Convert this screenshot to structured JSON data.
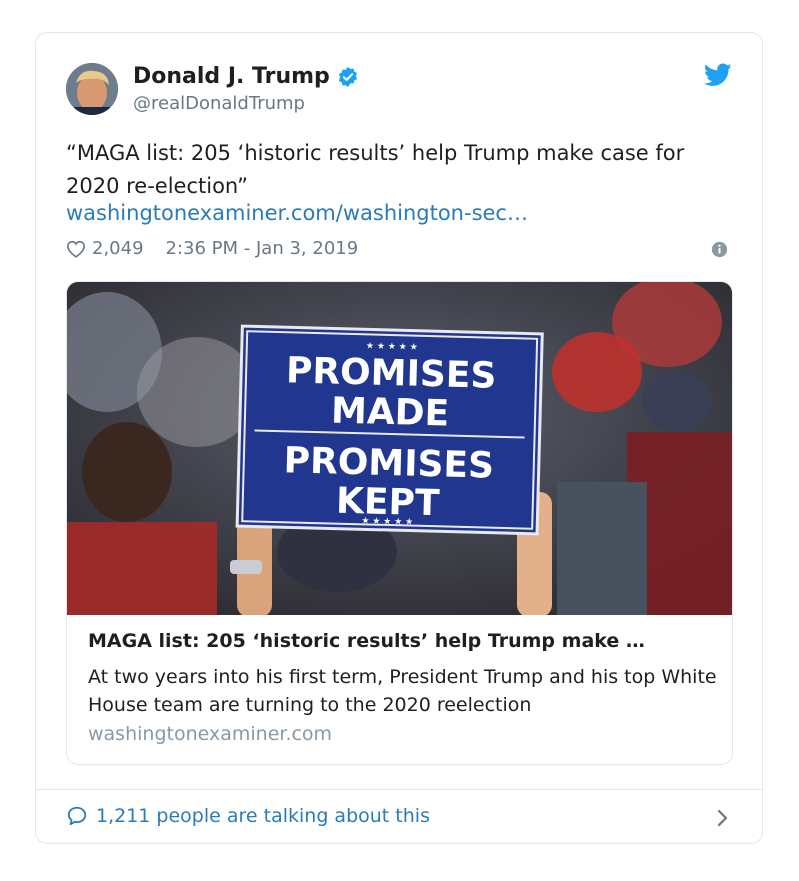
{
  "author": {
    "name": "Donald J. Trump",
    "handle": "@realDonaldTrump",
    "verified": true
  },
  "tweet": {
    "text": "“MAGA list: 205 ‘historic results’ help Trump make case for 2020 re-election”",
    "link": "washingtonexaminer.com/washington-sec…",
    "likes": "2,049",
    "timestamp": "2:36 PM - Jan 3, 2019"
  },
  "link_card": {
    "sign_lines": [
      "PROMISES",
      "MADE",
      "PROMISES",
      "KEPT"
    ],
    "title": "MAGA list: 205 ‘historic results’ help Trump make …",
    "description": "At two years into his first term, President Trump and his top White House team are turning to the 2020 reelection",
    "domain": "washingtonexaminer.com"
  },
  "footer": {
    "talking": "1,211 people are talking about this"
  },
  "colors": {
    "link": "#2b7bb9",
    "verified": "#1da1f2",
    "muted": "#697882",
    "sign_blue": "#1f3a93"
  },
  "icons": [
    "verified-badge-icon",
    "twitter-bird-icon",
    "heart-icon",
    "info-icon",
    "comment-icon",
    "chevron-right-icon"
  ]
}
